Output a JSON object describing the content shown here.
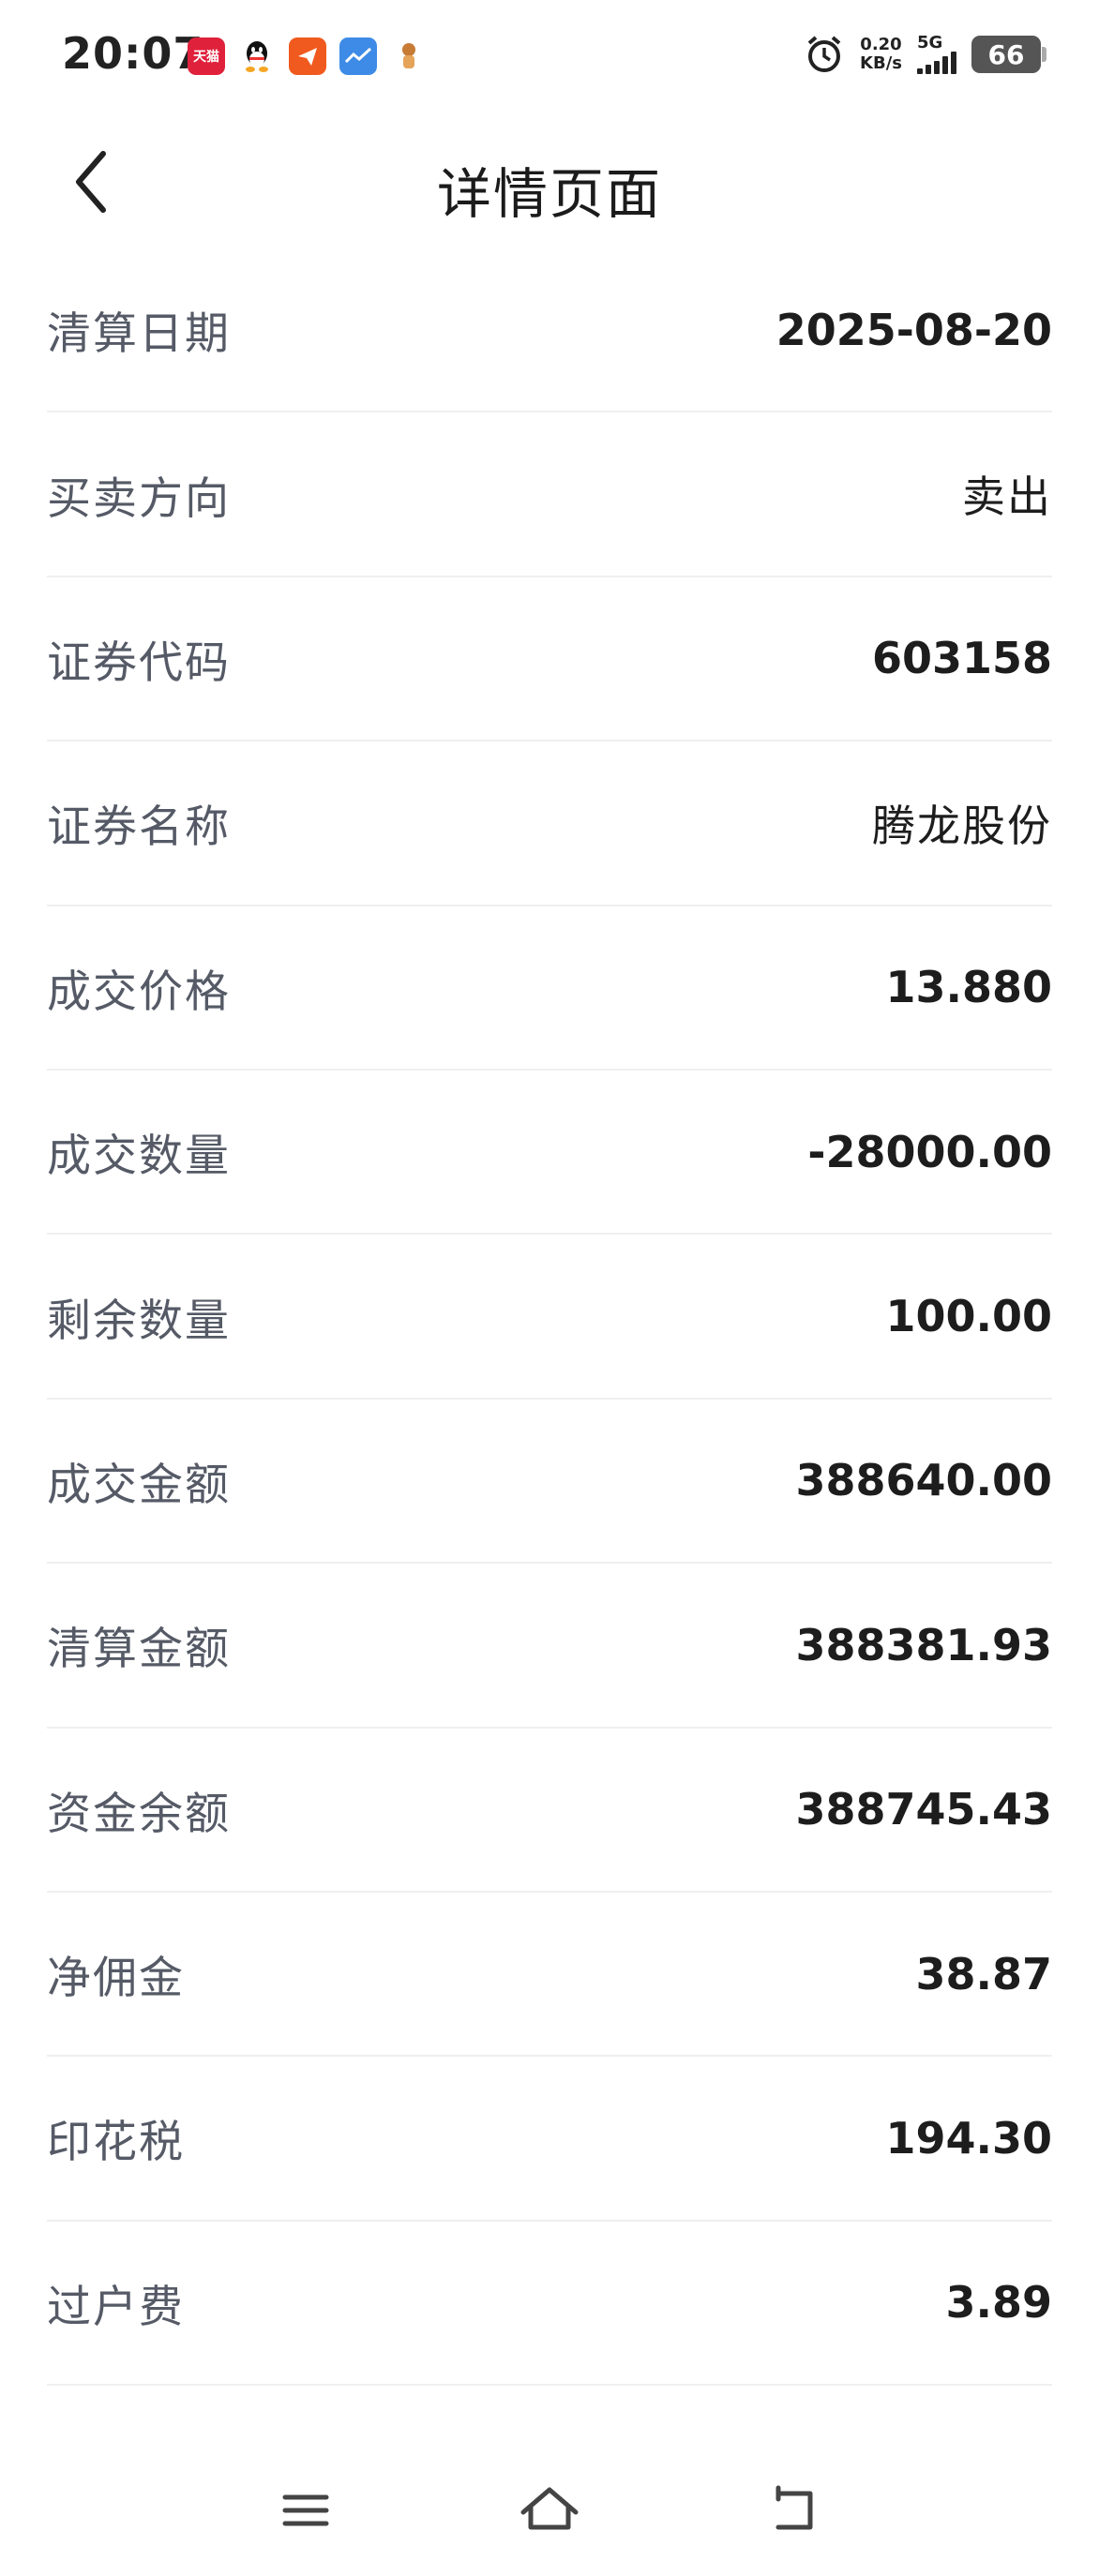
{
  "status_bar": {
    "time": "20:07",
    "app_icons": [
      {
        "name": "tmall-icon",
        "label": "天猫"
      },
      {
        "name": "qq-icon",
        "label": ""
      },
      {
        "name": "send-icon",
        "label": ""
      },
      {
        "name": "chart-app-icon",
        "label": ""
      },
      {
        "name": "misc-app-icon",
        "label": ""
      }
    ],
    "net_speed_value": "0.20",
    "net_speed_unit": "KB/s",
    "network": "5G",
    "battery": "66"
  },
  "header": {
    "title": "详情页面"
  },
  "details": [
    {
      "label": "清算日期",
      "value": "2025-08-20"
    },
    {
      "label": "买卖方向",
      "value": "卖出"
    },
    {
      "label": "证券代码",
      "value": "603158"
    },
    {
      "label": "证券名称",
      "value": "腾龙股份"
    },
    {
      "label": "成交价格",
      "value": "13.880"
    },
    {
      "label": "成交数量",
      "value": "-28000.00"
    },
    {
      "label": "剩余数量",
      "value": "100.00"
    },
    {
      "label": "成交金额",
      "value": "388640.00"
    },
    {
      "label": "清算金额",
      "value": "388381.93"
    },
    {
      "label": "资金余额",
      "value": "388745.43"
    },
    {
      "label": "净佣金",
      "value": "38.87"
    },
    {
      "label": "印花税",
      "value": "194.30"
    },
    {
      "label": "过户费",
      "value": "3.89"
    }
  ],
  "colors": {
    "label": "#555a66",
    "value": "#1d1d1d",
    "divider": "#efefef"
  }
}
